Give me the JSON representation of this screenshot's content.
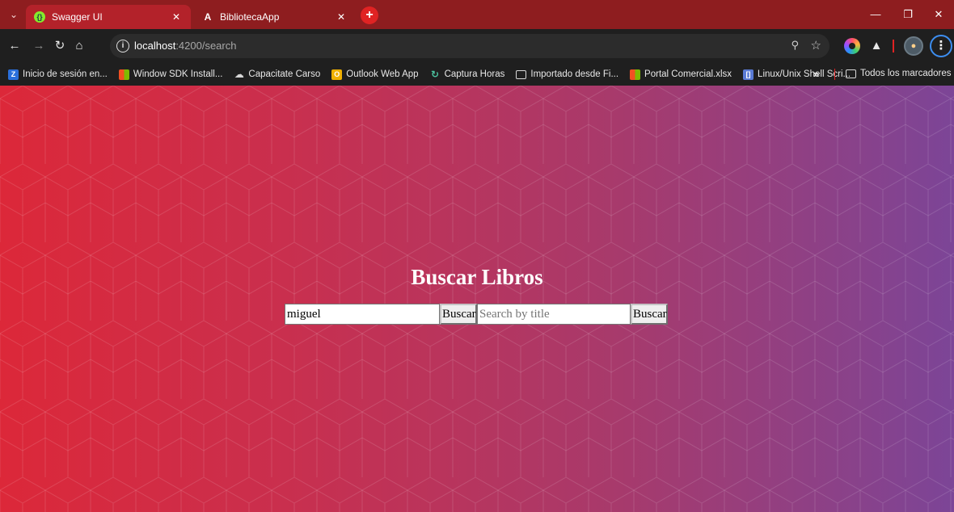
{
  "browser": {
    "tabs": [
      {
        "title": "Swagger UI",
        "favicon": "swagger-icon",
        "active": true
      },
      {
        "title": "BibliotecaApp",
        "favicon": "angular-icon",
        "active": false
      }
    ],
    "url_host": "localhost",
    "url_rest": ":4200/search",
    "accent_color": "#8e1d1f"
  },
  "bookmarks": [
    {
      "label": "Inicio de sesión en...",
      "icon": "zoho-icon"
    },
    {
      "label": "Window SDK Install...",
      "icon": "microsoft-icon"
    },
    {
      "label": "Capacitate Carso",
      "icon": "cloud-icon"
    },
    {
      "label": "Outlook Web App",
      "icon": "outlook-icon"
    },
    {
      "label": "Captura Horas",
      "icon": "captura-icon"
    },
    {
      "label": "Importado desde Fi...",
      "icon": "folder-icon"
    },
    {
      "label": "Portal Comercial.xlsx",
      "icon": "microsoft-icon"
    },
    {
      "label": "Linux/Unix Shell Scri...",
      "icon": "linux-icon"
    }
  ],
  "bookmarks_all": "Todos los marcadores",
  "page": {
    "title": "Buscar Libros",
    "author_search": {
      "value": "miguel",
      "button": "Buscar"
    },
    "title_search": {
      "placeholder": "Search by title",
      "value": "",
      "button": "Buscar"
    },
    "gradient": [
      "#dc2839",
      "#7c4597"
    ]
  }
}
